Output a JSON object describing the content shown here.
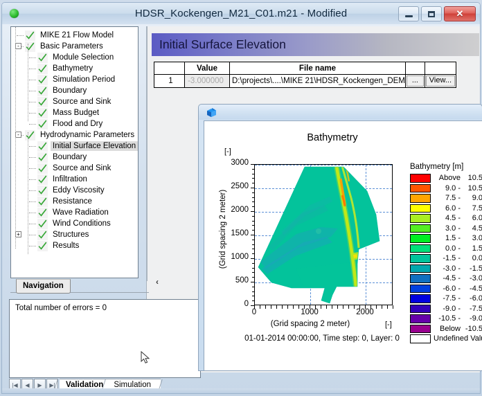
{
  "window": {
    "title": "HDSR_Kockengen_M21_C01.m21 - Modified",
    "app_icon": "green-status-dot",
    "buttons": {
      "minimize": "minimize-icon",
      "maximize": "maximize-icon",
      "close": "✕"
    }
  },
  "navigation": {
    "tab_label": "Navigation",
    "tree": [
      {
        "label": "MIKE 21 Flow Model",
        "depth": 0,
        "checked": true,
        "expander": null,
        "selected": false
      },
      {
        "label": "Basic Parameters",
        "depth": 0,
        "checked": true,
        "expander": "-",
        "selected": false
      },
      {
        "label": "Module Selection",
        "depth": 1,
        "checked": true,
        "expander": null,
        "selected": false
      },
      {
        "label": "Bathymetry",
        "depth": 1,
        "checked": true,
        "expander": null,
        "selected": false
      },
      {
        "label": "Simulation Period",
        "depth": 1,
        "checked": true,
        "expander": null,
        "selected": false
      },
      {
        "label": "Boundary",
        "depth": 1,
        "checked": true,
        "expander": null,
        "selected": false
      },
      {
        "label": "Source and Sink",
        "depth": 1,
        "checked": true,
        "expander": null,
        "selected": false
      },
      {
        "label": "Mass Budget",
        "depth": 1,
        "checked": true,
        "expander": null,
        "selected": false
      },
      {
        "label": "Flood and Dry",
        "depth": 1,
        "checked": true,
        "expander": null,
        "selected": false
      },
      {
        "label": "Hydrodynamic Parameters",
        "depth": 0,
        "checked": true,
        "expander": "-",
        "selected": false
      },
      {
        "label": "Initial Surface Elevation",
        "depth": 1,
        "checked": true,
        "expander": null,
        "selected": true
      },
      {
        "label": "Boundary",
        "depth": 1,
        "checked": true,
        "expander": null,
        "selected": false
      },
      {
        "label": "Source and Sink",
        "depth": 1,
        "checked": true,
        "expander": null,
        "selected": false
      },
      {
        "label": "Infiltration",
        "depth": 1,
        "checked": true,
        "expander": null,
        "selected": false
      },
      {
        "label": "Eddy Viscosity",
        "depth": 1,
        "checked": true,
        "expander": null,
        "selected": false
      },
      {
        "label": "Resistance",
        "depth": 1,
        "checked": true,
        "expander": null,
        "selected": false
      },
      {
        "label": "Wave Radiation",
        "depth": 1,
        "checked": true,
        "expander": null,
        "selected": false
      },
      {
        "label": "Wind Conditions",
        "depth": 1,
        "checked": true,
        "expander": null,
        "selected": false
      },
      {
        "label": "Structures",
        "depth": 1,
        "checked": true,
        "expander": "+",
        "selected": false
      },
      {
        "label": "Results",
        "depth": 1,
        "checked": true,
        "expander": null,
        "selected": false
      }
    ]
  },
  "validation": {
    "message": "Total number of errors = 0",
    "tabs": [
      {
        "label": "Validation",
        "active": true
      },
      {
        "label": "Simulation",
        "active": false
      }
    ],
    "nav_buttons": [
      "|◀",
      "◀",
      "▶",
      "▶|"
    ]
  },
  "page": {
    "banner_title": "Initial Surface Elevation",
    "collapse_arrow": "‹"
  },
  "grid": {
    "headers": [
      "",
      "Value",
      "File name",
      "",
      ""
    ],
    "rows": [
      {
        "num": "1",
        "value": "-3.000000",
        "file": "D:\\projects\\....\\MIKE 21\\HDSR_Kockengen_DEM",
        "browse_label": "...",
        "view_label": "View..."
      }
    ]
  },
  "plot_window": {
    "icon": "blue-cube-icon"
  },
  "chart_data": {
    "type": "heatmap",
    "title": "Bathymetry",
    "xlabel": "(Grid spacing 2 meter)",
    "ylabel": "(Grid spacing 2 meter)",
    "x_unit": "[-]",
    "y_unit": "[-]",
    "caption": "01-01-2014 00:00:00, Time step: 0, Layer: 0",
    "xlim": [
      0,
      2500
    ],
    "ylim": [
      0,
      3000
    ],
    "xticks": [
      0,
      1000,
      2000
    ],
    "yticks": [
      0,
      500,
      1000,
      1500,
      2000,
      2500,
      3000
    ],
    "grid": true,
    "legend_position": "right",
    "legend_title": "Bathymetry [m]",
    "legend_entries": [
      {
        "color": "#ff0000",
        "lo": "Above",
        "hi": "10.5"
      },
      {
        "color": "#ff5500",
        "lo": "9.0 -",
        "hi": "10.5"
      },
      {
        "color": "#ffa500",
        "lo": "7.5 -",
        "hi": "9.0"
      },
      {
        "color": "#ffff00",
        "lo": "6.0 -",
        "hi": "7.5"
      },
      {
        "color": "#aaee22",
        "lo": "4.5 -",
        "hi": "6.0"
      },
      {
        "color": "#55ee22",
        "lo": "3.0 -",
        "hi": "4.5"
      },
      {
        "color": "#00ee22",
        "lo": "1.5 -",
        "hi": "3.0"
      },
      {
        "color": "#00e07a",
        "lo": "0.0 -",
        "hi": "1.5"
      },
      {
        "color": "#00c49b",
        "lo": "-1.5 -",
        "hi": "0.0"
      },
      {
        "color": "#00a8ae",
        "lo": "-3.0 -",
        "hi": "-1.5"
      },
      {
        "color": "#1070c0",
        "lo": "-4.5 -",
        "hi": "-3.0"
      },
      {
        "color": "#0040e0",
        "lo": "-6.0 -",
        "hi": "-4.5"
      },
      {
        "color": "#0000e0",
        "lo": "-7.5 -",
        "hi": "-6.0"
      },
      {
        "color": "#3300bb",
        "lo": "-9.0 -",
        "hi": "-7.5"
      },
      {
        "color": "#6600aa",
        "lo": "-10.5 -",
        "hi": "-9.0"
      },
      {
        "color": "#99008f",
        "lo": "Below",
        "hi": "-10.5"
      },
      {
        "color": "#ffffff",
        "full": "Undefined Value"
      }
    ]
  }
}
